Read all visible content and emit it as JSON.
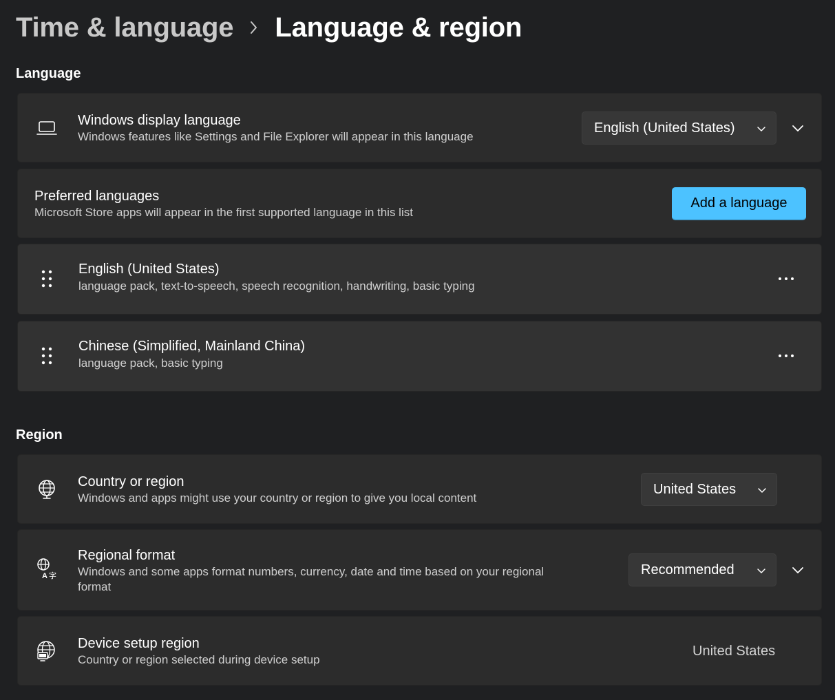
{
  "breadcrumb": {
    "parent": "Time & language",
    "current": "Language & region"
  },
  "language_section": {
    "title": "Language",
    "display_language": {
      "title": "Windows display language",
      "subtitle": "Windows features like Settings and File Explorer will appear in this language",
      "selected": "English (United States)",
      "icon": "laptop-icon"
    },
    "preferred": {
      "title": "Preferred languages",
      "subtitle": "Microsoft Store apps will appear in the first supported language in this list",
      "add_button": "Add a language"
    },
    "languages": [
      {
        "name": "English (United States)",
        "features": "language pack, text-to-speech, speech recognition, handwriting, basic typing"
      },
      {
        "name": "Chinese (Simplified, Mainland China)",
        "features": "language pack, basic typing"
      }
    ]
  },
  "region_section": {
    "title": "Region",
    "country": {
      "title": "Country or region",
      "subtitle": "Windows and apps might use your country or region to give you local content",
      "selected": "United States",
      "icon": "globe-icon"
    },
    "format": {
      "title": "Regional format",
      "subtitle_line1": "Windows and some apps format numbers, currency, date and time based on your regional",
      "subtitle_line2": "format",
      "selected": "Recommended",
      "icon": "language-format-icon"
    },
    "device_setup": {
      "title": "Device setup region",
      "subtitle": "Country or region selected during device setup",
      "value": "United States",
      "icon": "globe-computer-icon"
    }
  },
  "colors": {
    "background": "#1f2022",
    "card": "#2c2c2c",
    "accent": "#4cc2ff"
  }
}
